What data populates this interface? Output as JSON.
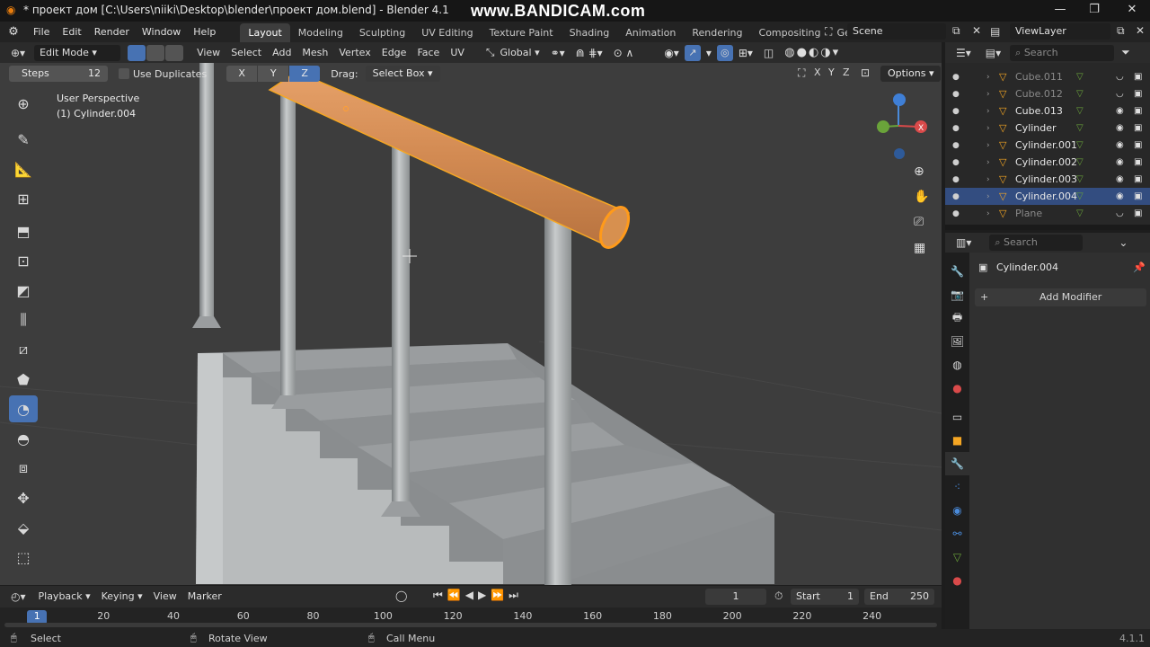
{
  "window": {
    "title": "* проект дом [C:\\Users\\niiki\\Desktop\\blender\\проект дом.blend] - Blender 4.1",
    "watermark": "www.BANDICAM.com"
  },
  "menu": [
    "File",
    "Edit",
    "Render",
    "Window",
    "Help"
  ],
  "workspaces": [
    "Layout",
    "Modeling",
    "Sculpting",
    "UV Editing",
    "Texture Paint",
    "Shading",
    "Animation",
    "Rendering",
    "Compositing",
    "Geom"
  ],
  "scene": "Scene",
  "view_layer": "ViewLayer",
  "viewport_header": {
    "mode": "Edit Mode",
    "menus": [
      "View",
      "Select",
      "Add",
      "Mesh",
      "Vertex",
      "Edge",
      "Face",
      "UV"
    ],
    "orientation": "Global"
  },
  "operator": {
    "steps_label": "Steps",
    "steps_value": "12",
    "use_duplicates": "Use Duplicates",
    "axes": [
      "X",
      "Y",
      "Z"
    ],
    "active_axis": "Z",
    "drag_label": "Drag:",
    "drag_value": "Select Box",
    "xyz": [
      "X",
      "Y",
      "Z"
    ],
    "options": "Options"
  },
  "viewport": {
    "view_name": "User Perspective",
    "object_name": "(1) Cylinder.004"
  },
  "outliner": {
    "search_placeholder": "Search",
    "items": [
      {
        "name": "Cube.011",
        "dim": true,
        "selected": false
      },
      {
        "name": "Cube.012",
        "dim": true,
        "selected": false
      },
      {
        "name": "Cube.013",
        "dim": false,
        "selected": false
      },
      {
        "name": "Cylinder",
        "dim": false,
        "selected": false
      },
      {
        "name": "Cylinder.001",
        "dim": false,
        "selected": false
      },
      {
        "name": "Cylinder.002",
        "dim": false,
        "selected": false
      },
      {
        "name": "Cylinder.003",
        "dim": false,
        "selected": false
      },
      {
        "name": "Cylinder.004",
        "dim": false,
        "selected": true
      },
      {
        "name": "Plane",
        "dim": true,
        "selected": false
      }
    ]
  },
  "properties": {
    "search_placeholder": "Search",
    "object": "Cylinder.004",
    "add_modifier": "Add Modifier"
  },
  "timeline": {
    "menus": [
      "Playback",
      "Keying",
      "View",
      "Marker"
    ],
    "current_frame": "1",
    "start_label": "Start",
    "start": "1",
    "end_label": "End",
    "end": "250",
    "ruler": [
      "1",
      "20",
      "40",
      "60",
      "80",
      "100",
      "120",
      "140",
      "160",
      "180",
      "200",
      "220",
      "240"
    ]
  },
  "status": {
    "select": "Select",
    "rotate": "Rotate View",
    "call_menu": "Call Menu",
    "version": "4.1.1"
  },
  "colors": {
    "accent": "#4772b3",
    "selection_orange": "#f5a623",
    "panel": "#303030"
  }
}
